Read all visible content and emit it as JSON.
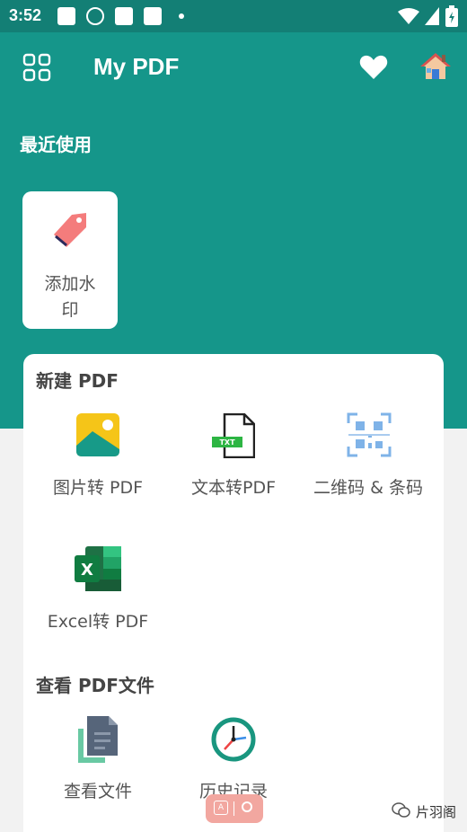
{
  "status": {
    "time": "3:52"
  },
  "appbar": {
    "title": "My PDF",
    "menu_icon": "grid-icon",
    "fav_icon": "heart-icon",
    "home_icon": "home-icon"
  },
  "recent": {
    "title": "最近使用",
    "items": [
      {
        "line1": "添加水",
        "line2": "印",
        "icon": "tag-icon"
      }
    ]
  },
  "create": {
    "title": "新建 PDF",
    "tools": [
      {
        "label": "图片转 PDF",
        "icon": "image-icon"
      },
      {
        "label": "文本转PDF",
        "icon": "txt-file-icon"
      },
      {
        "label": "二维码 & 条码",
        "icon": "qr-scan-icon"
      },
      {
        "label": "Excel转 PDF",
        "icon": "excel-icon"
      }
    ]
  },
  "view": {
    "title": "查看 PDF文件",
    "tools": [
      {
        "label": "查看文件",
        "icon": "documents-icon"
      },
      {
        "label": "历史记录",
        "icon": "clock-icon"
      }
    ]
  },
  "overlay": {
    "watermark": "片羽阁"
  },
  "colors": {
    "primary": "#15968a",
    "status_bar": "#137f75",
    "card": "#ffffff",
    "tag": "#f47c7c"
  }
}
